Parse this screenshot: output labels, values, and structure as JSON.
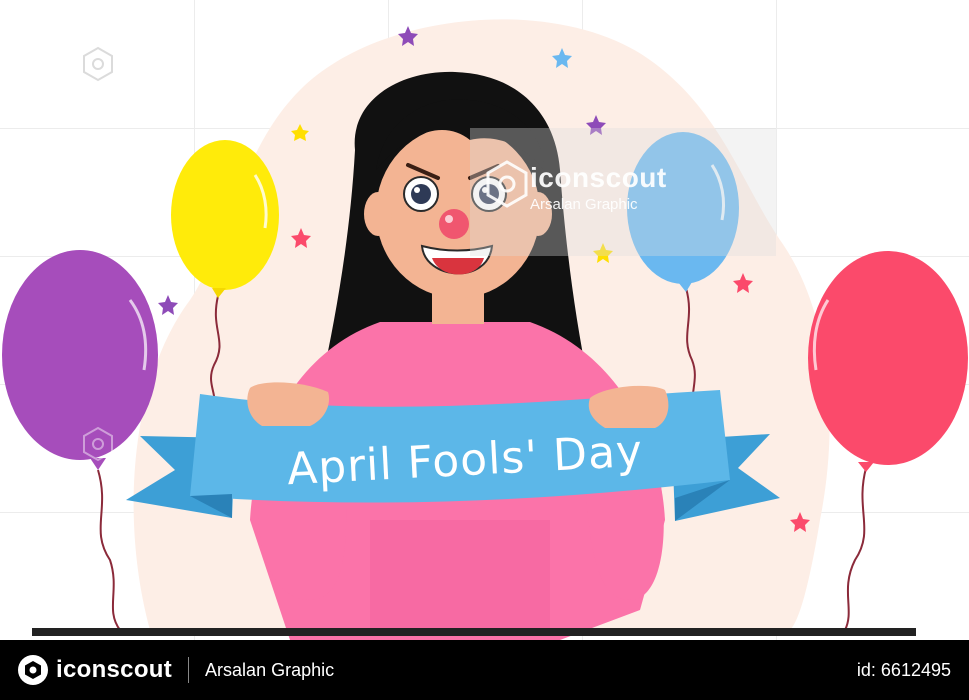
{
  "banner": {
    "text": "April Fools' Day"
  },
  "watermark": {
    "brand": "iconscout",
    "author": "Arsalan Graphic"
  },
  "footer": {
    "brand": "iconscout",
    "author": "Arsalan Graphic",
    "id_text": "id: 6612495"
  },
  "colors": {
    "background_blob": "#fdeee6",
    "balloon_purple": "#a64dbb",
    "balloon_yellow": "#ffeb0a",
    "balloon_blue": "#6ab8f0",
    "balloon_red": "#fb4a6b",
    "sweater": "#fb73a9",
    "banner": "#5cb7e8",
    "hair": "#111111",
    "skin": "#f3b493"
  }
}
